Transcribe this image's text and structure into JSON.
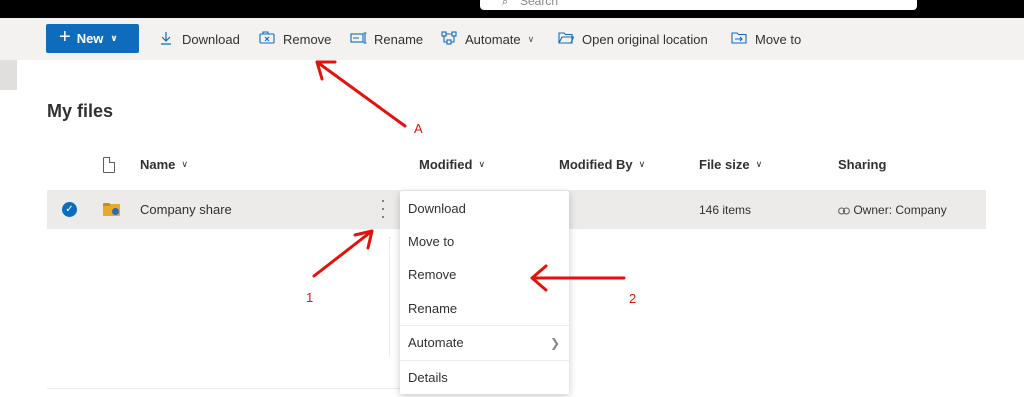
{
  "search": {
    "placeholder": "Search"
  },
  "toolbar": {
    "new_label": "New",
    "download_label": "Download",
    "remove_label": "Remove",
    "rename_label": "Rename",
    "automate_label": "Automate",
    "open_location_label": "Open original location",
    "move_to_label": "Move to"
  },
  "page": {
    "title": "My files"
  },
  "columns": {
    "name": "Name",
    "modified": "Modified",
    "modified_by": "Modified By",
    "file_size": "File size",
    "sharing": "Sharing"
  },
  "rows": [
    {
      "name": "Company share",
      "file_size": "146 items",
      "sharing": "Owner: Company"
    }
  ],
  "context_menu": {
    "items": [
      "Download",
      "Move to",
      "Remove",
      "Rename",
      "Automate",
      "Details"
    ]
  },
  "annotations": {
    "a": "A",
    "one": "1",
    "two": "2"
  },
  "colors": {
    "accent": "#0f6cbd",
    "annotation": "#e3120b",
    "selected_row": "#edebe9",
    "command_bar": "#f3f2f1"
  },
  "icons": {
    "new": "plus-icon",
    "download": "download-icon",
    "remove": "remove-icon",
    "rename": "rename-icon",
    "automate": "automate-icon",
    "open_location": "folder-open-icon",
    "move_to": "move-to-icon",
    "row_check": "checkmark-icon",
    "row_type": "shared-folder-icon",
    "row_more": "more-vertical-icon",
    "sharing": "link-icon",
    "submenu": "chevron-right-icon"
  }
}
